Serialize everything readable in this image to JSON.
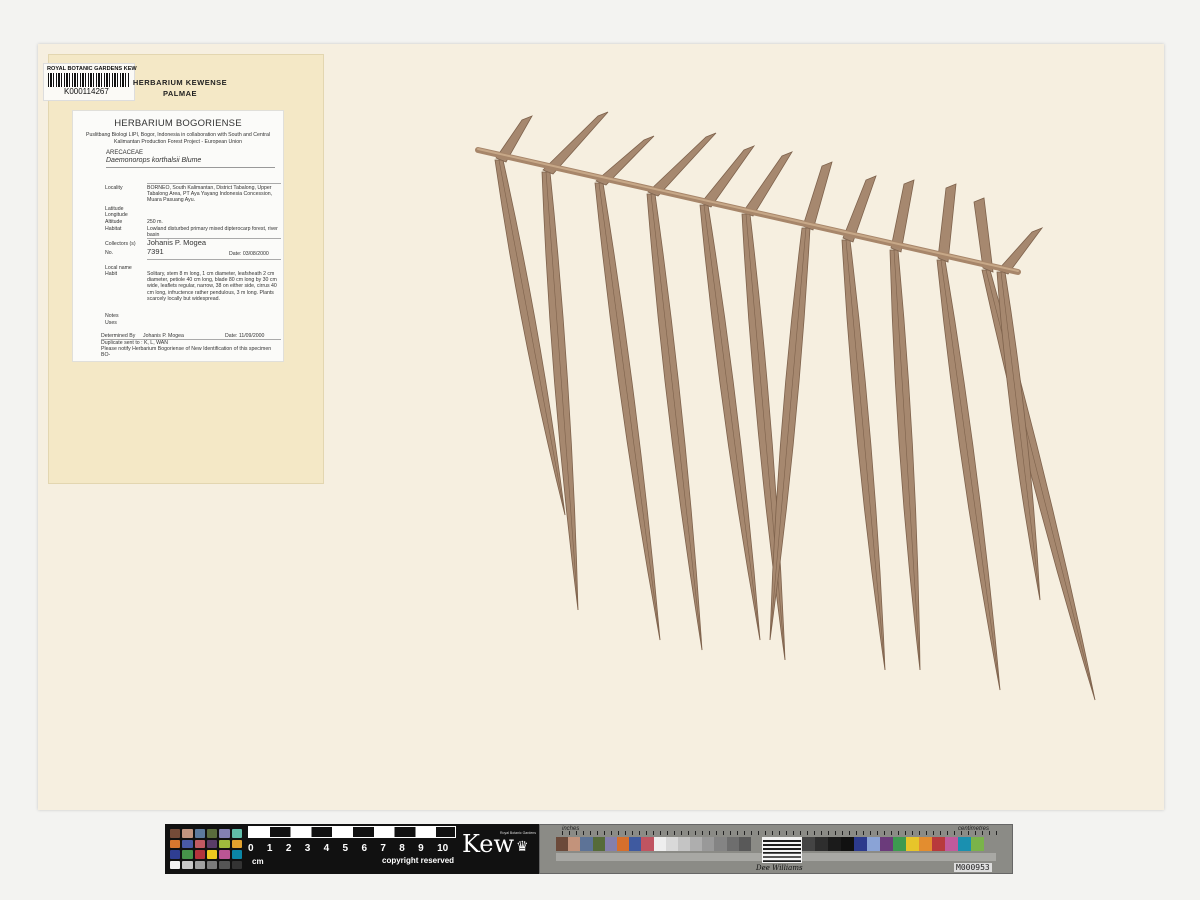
{
  "kew_tag": {
    "institution": "ROYAL BOTANIC GARDENS KEW",
    "barcode": "K000114267"
  },
  "herbarium_kewense": {
    "line1": "HERBARIUM KEWENSE",
    "line2": "PALMAE"
  },
  "label": {
    "title": "HERBARIUM BOGORIENSE",
    "subtitle": "Puslitbang Biologi LIPI, Bogor, Indonesia in collaboration with South and Central Kalimantan Production Forest Project - European Union",
    "family": "ARECACEAE",
    "species": "Daemonorops korthalsii Blume",
    "fields": {
      "locality_key": "Locality",
      "locality": "BORNEO, South Kalimantan, District Tabalong, Upper Tabalong Area, PT Aya Yayang Indonesia Concession, Muara Pasuang Ayu.",
      "latitude_key": "Latitude",
      "longitude_key": "Longitude",
      "altitude_key": "Altitude",
      "altitude": "250 m.",
      "habitat_key": "Habitat",
      "habitat": "Lowland disturbed primary mixed dipterocarp forest, river basin",
      "collectors_key": "Collectors (s)",
      "collectors": "Johanis P. Mogea",
      "no_key": "No.",
      "no": "7391",
      "date": "Date: 03/08/2000",
      "localname_key": "Local name",
      "habit_key": "Habit",
      "habit": "Solitary, stem 8 m long, 1 cm diameter, leafsheath 2 cm diameter, petiole 40 cm long, blade 80 cm long by 30 cm wide, leaflets regular, narrow, 38 on either side, cirrus 40 cm long, infructence rather pendulous, 3 m long. Plants scarcely locally but widespread.",
      "notes_key": "Notes",
      "uses_key": "Uses",
      "determined_key": "Determined By",
      "determined": "Johanis P. Mogea",
      "determined_date": "Date: 11/09/2000",
      "duplicate": "Duplicate sent to : K, L, WAN",
      "notify": "Please notify Herbarium Bogoriense of New Identification of this specimen BO-"
    }
  },
  "scale_bar": {
    "numbers": [
      "0",
      "1",
      "2",
      "3",
      "4",
      "5",
      "6",
      "7",
      "8",
      "9",
      "10"
    ],
    "unit": "cm",
    "copyright": "copyright reserved",
    "logo": "Kew",
    "logo_sub": "Royal Botanic Gardens",
    "inches": "inches",
    "centimetres": "centimetres",
    "signature": "Dee Williams",
    "mcode": "M000953"
  },
  "colors": {
    "sheet": "#f6efe0",
    "leaf": "#a6886f",
    "leaf_dark": "#7e624c",
    "rachis": "#b08f70"
  }
}
